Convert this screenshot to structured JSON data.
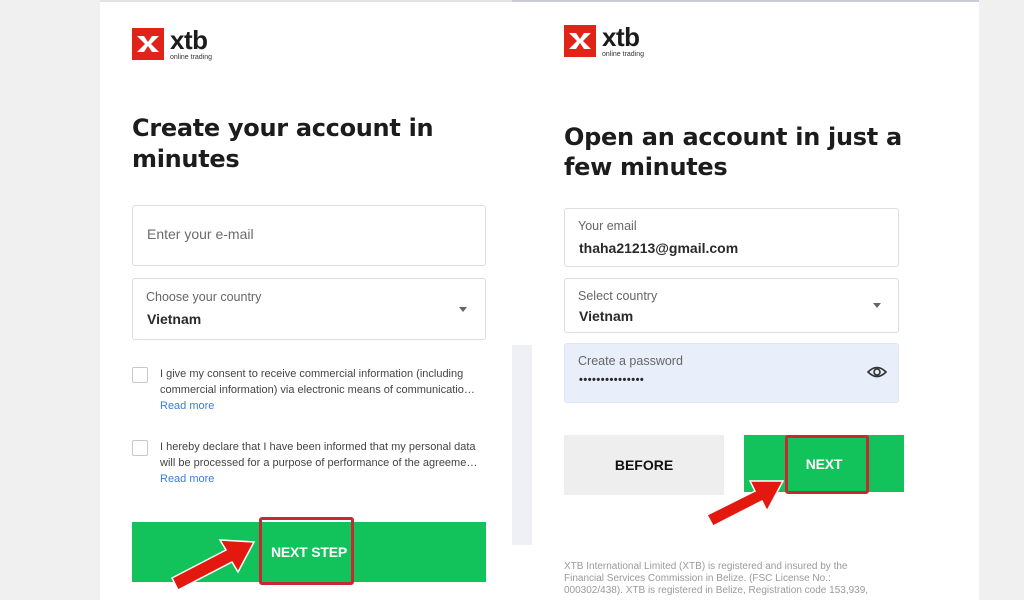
{
  "left_panel": {
    "logo": {
      "word": "xtb",
      "tagline": "online trading"
    },
    "headline_line1": "Create your account in",
    "headline_line2": "minutes",
    "email_placeholder": "Enter your e-mail",
    "country_label": "Choose your country",
    "country_value": "Vietnam",
    "consent1_line1": "I give my consent to receive commercial information (including",
    "consent1_line2": "commercial information) via electronic means of communication...",
    "consent1_link": "Read more",
    "consent2_line1": "I hereby declare that I have been informed that my personal data",
    "consent2_line2": "will be processed for a purpose of performance of the agreement...",
    "consent2_link": "Read more",
    "next_step_label": "NEXT STEP"
  },
  "right_panel": {
    "logo": {
      "word": "xtb",
      "tagline": "online trading"
    },
    "headline_line1": "Open an account in just a",
    "headline_line2": "few minutes",
    "email_label": "Your email",
    "email_value": "thaha21213@gmail.com",
    "country_label": "Select country",
    "country_value": "Vietnam",
    "password_label": "Create a password",
    "password_value": "•••••••••••••••",
    "before_label": "BEFORE",
    "next_label": "NEXT",
    "footer_line1": "XTB International Limited (XTB) is registered and insured by the",
    "footer_line2": "Financial Services Commission in Belize. (FSC License No.:",
    "footer_line3": "000302/438). XTB is registered in Belize, Registration code 153,939,"
  },
  "colors": {
    "brand_red": "#e2231a",
    "button_green": "#12c25a",
    "highlight_red": "#c42a33",
    "arrow_red": "#e3180f",
    "link_blue": "#3b7dd8",
    "password_field_bg": "#e9eefb"
  },
  "icons": {
    "logo": "xtb-x-logo-icon",
    "dropdown": "caret-down-icon",
    "password_toggle": "eye-icon",
    "pointer": "red-arrow-icon"
  }
}
